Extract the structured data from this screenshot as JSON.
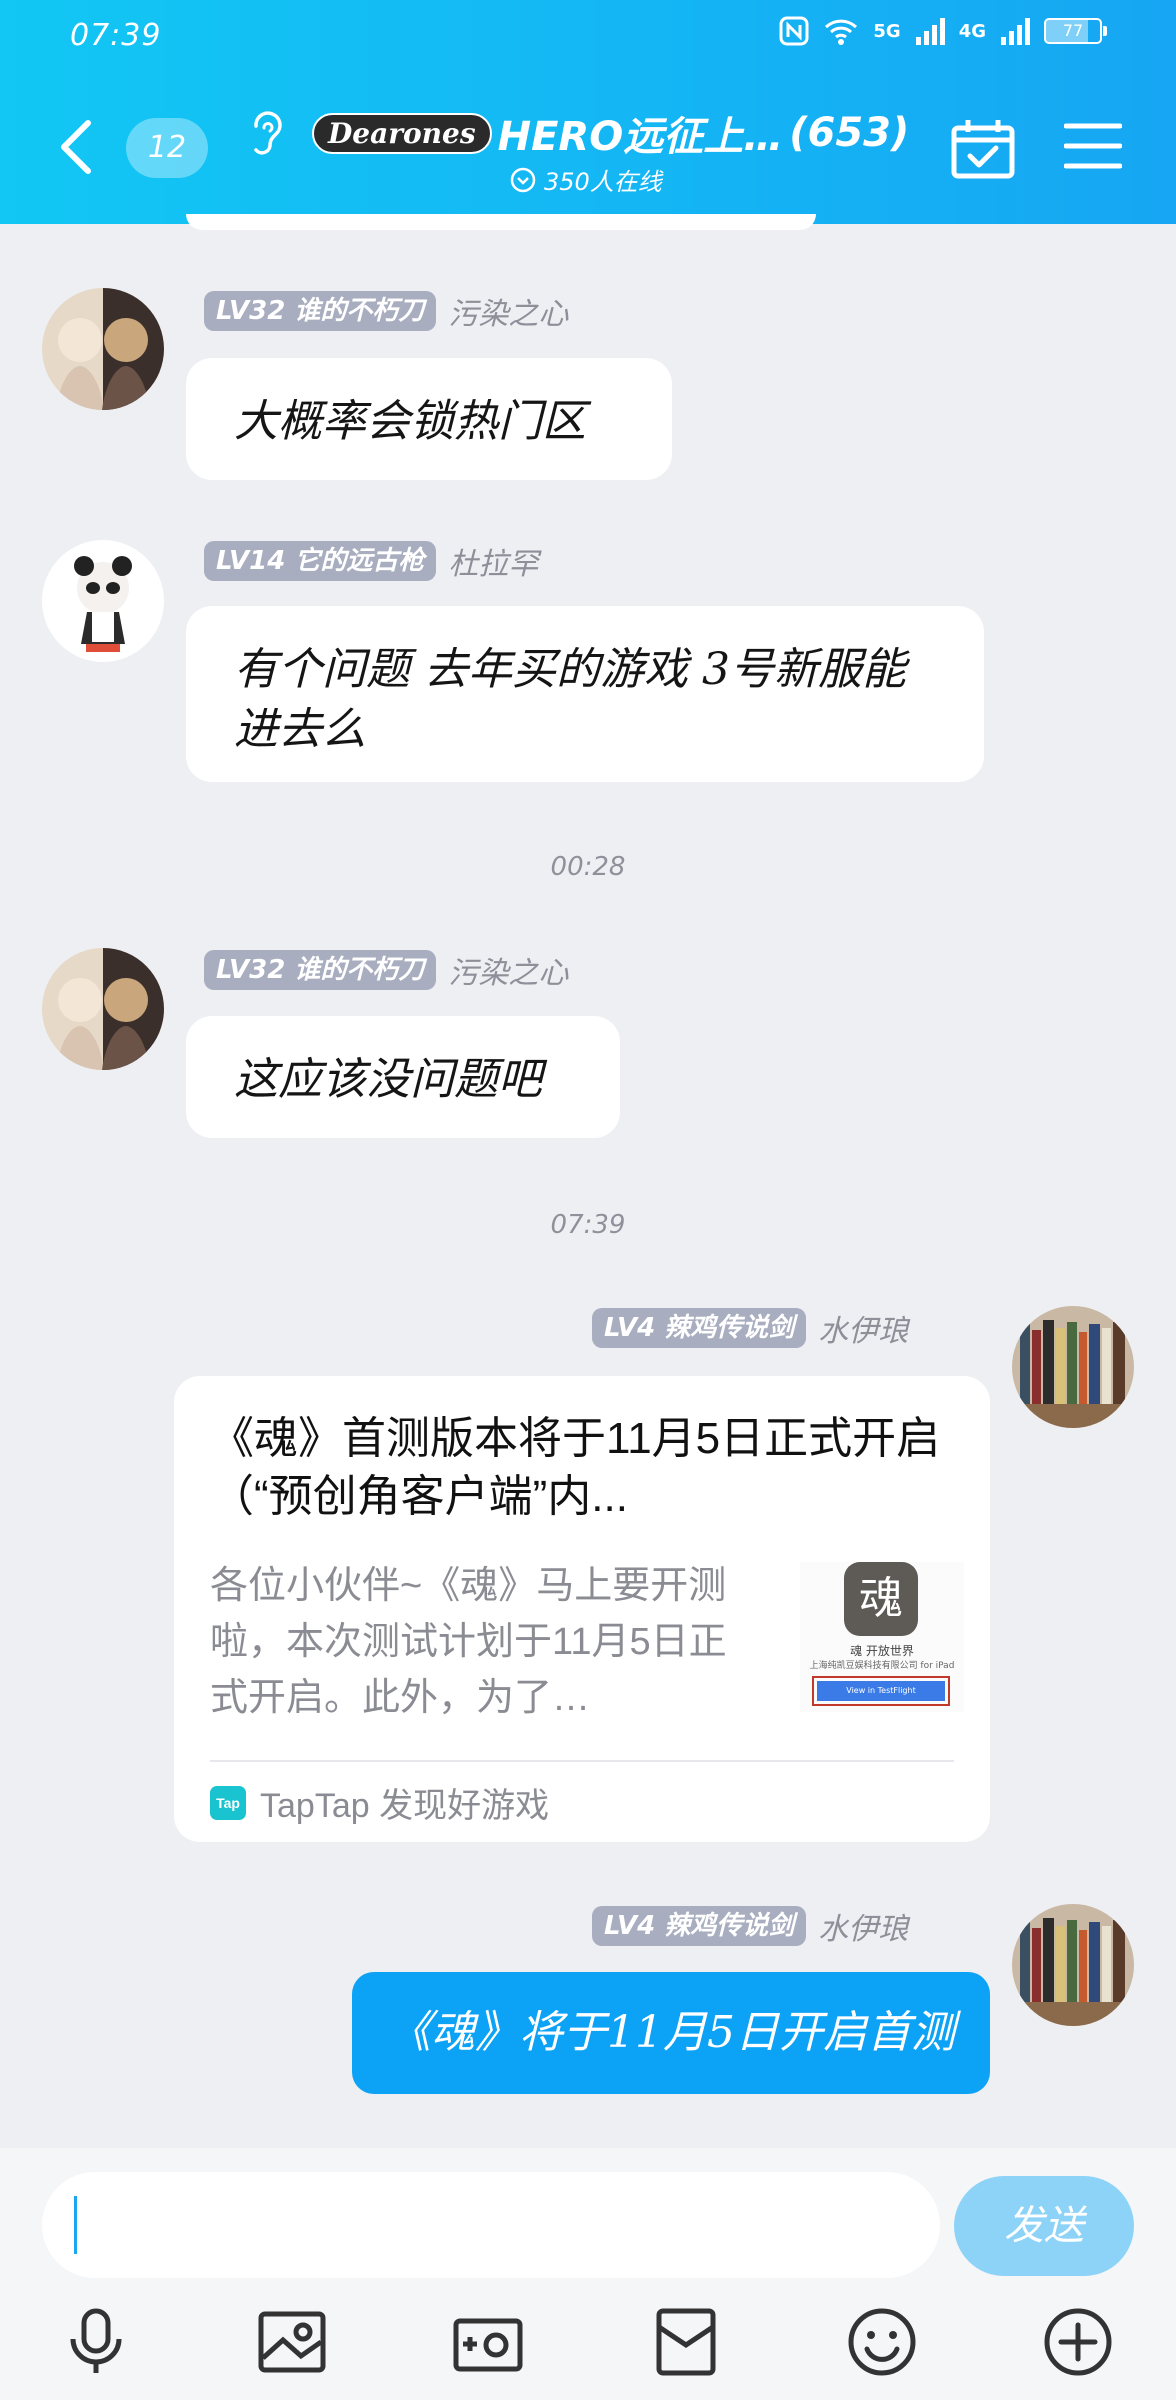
{
  "status_bar": {
    "time": "07:39",
    "net1": "5G",
    "net2": "4G",
    "battery": "77"
  },
  "header": {
    "unread_count": "12",
    "logo_text": "Dearones",
    "group_name": "HERO远征上…",
    "member_count": "(653)",
    "online_text": "350人在线"
  },
  "messages": [
    {
      "title_tag": "LV32 谁的不朽刀",
      "nickname": "污染之心",
      "text": "大概率会锁热门区"
    },
    {
      "title_tag": "LV14 它的远古枪",
      "nickname": "杜拉罕",
      "text": "有个问题 去年买的游戏 3号新服能进去么"
    },
    {
      "time": "00:28"
    },
    {
      "title_tag": "LV32 谁的不朽刀",
      "nickname": "污染之心",
      "text": "这应该没问题吧"
    },
    {
      "time": "07:39"
    },
    {
      "title_tag": "LV4 辣鸡传说剑",
      "nickname": "水伊琅",
      "card": {
        "title": "《魂》首测版本将于11月5日正式开启（“预创角客户端”内...",
        "description": "各位小伙伴~《魂》马上要开测啦，本次测试计划于11月5日正式开启。此外，为了…",
        "thumb_char": "魂",
        "thumb_line1": "魂 开放世界",
        "thumb_line2": "上海纯凯豆娱科技有限公司 for iPad",
        "thumb_button": "View in TestFlight",
        "source_logo": "Tap",
        "source": "TapTap 发现好游戏"
      }
    },
    {
      "title_tag": "LV4 辣鸡传说剑",
      "nickname": "水伊琅",
      "text": "《魂》将于11月5日开启首测"
    }
  ],
  "input": {
    "value": "",
    "placeholder": "",
    "send_label": "发送"
  },
  "toolbar": [
    "mic-icon",
    "image-icon",
    "camera-icon",
    "red-envelope-icon",
    "emoji-icon",
    "plus-icon"
  ],
  "colors": {
    "header": "#14b6f4",
    "self_bubble": "#0ca2f5",
    "send_button": "#8dd3f8",
    "title_tag": "#a8adbf"
  }
}
